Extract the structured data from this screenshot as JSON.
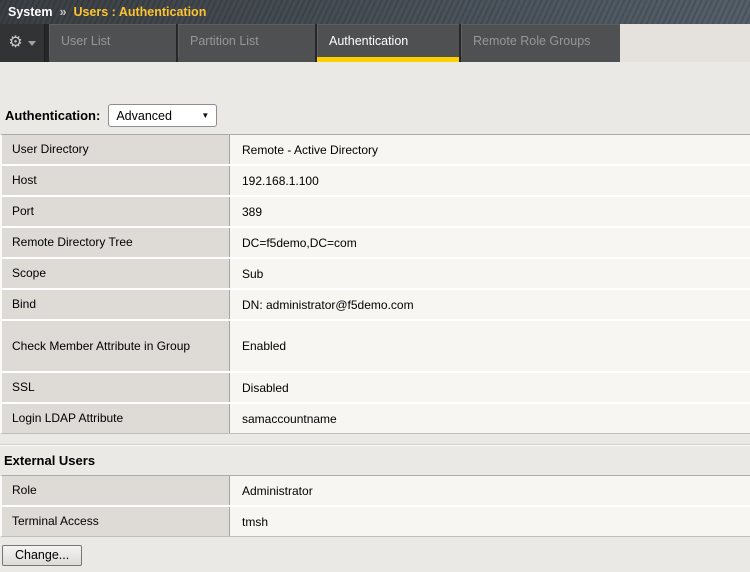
{
  "breadcrumb": {
    "section": "System",
    "separator": "»",
    "page": "Users : Authentication"
  },
  "tab_bar": {
    "gear_menu": {
      "icon": "gear-icon",
      "chevron": "chevron-down-icon"
    },
    "tabs": [
      {
        "label": "User List",
        "active": false
      },
      {
        "label": "Partition List",
        "active": false
      },
      {
        "label": "Authentication",
        "active": true
      },
      {
        "label": "Remote Role Groups",
        "active": false
      }
    ]
  },
  "form": {
    "label": "Authentication:",
    "dropdown": {
      "value": "Advanced",
      "icon": "dropdown-arrow-icon",
      "arrow": "▼"
    }
  },
  "auth_settings": {
    "rows": [
      {
        "label": "User Directory",
        "value": "Remote - Active Directory"
      },
      {
        "label": "Host",
        "value": "192.168.1.100"
      },
      {
        "label": "Port",
        "value": "389"
      },
      {
        "label": "Remote Directory Tree",
        "value": "DC=f5demo,DC=com"
      },
      {
        "label": "Scope",
        "value": "Sub"
      },
      {
        "label": "Bind",
        "value": "DN: administrator@f5demo.com"
      },
      {
        "label": "Check Member Attribute in Group",
        "value": "Enabled"
      },
      {
        "label": "SSL",
        "value": "Disabled"
      },
      {
        "label": "Login LDAP Attribute",
        "value": "samaccountname"
      }
    ]
  },
  "external_users": {
    "heading": "External Users",
    "rows": [
      {
        "label": "Role",
        "value": "Administrator"
      },
      {
        "label": "Terminal Access",
        "value": "tmsh"
      }
    ]
  },
  "footer": {
    "change_button": "Change..."
  },
  "colors": {
    "accent_yellow": "#ffd000",
    "breadcrumb_gold": "#fdc431",
    "header_bg": "#474f58",
    "tab_bg": "#4e5052",
    "tab_text_inactive": "#94989c",
    "label_cell_bg": "#dedbd7",
    "value_cell_bg": "#f7f6f3",
    "page_bg": "#ebe9e6"
  }
}
